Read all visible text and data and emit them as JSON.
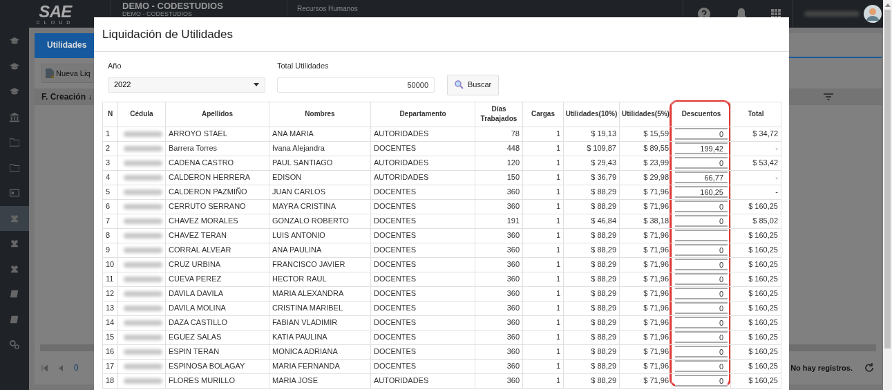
{
  "header": {
    "logo": "SAE",
    "logo_sub": "CLOUD",
    "company": "DEMO - CODESTUDIOS",
    "company_sub": "DEMO - CODESTUDIOS",
    "module": "Recursos Humanos"
  },
  "sidebar": {
    "items": [
      {
        "kind": "cap",
        "selected": false
      },
      {
        "kind": "cap",
        "selected": false
      },
      {
        "kind": "cap",
        "selected": false
      },
      {
        "kind": "bank",
        "selected": false
      },
      {
        "kind": "folder",
        "selected": false
      },
      {
        "kind": "folder",
        "selected": false
      },
      {
        "kind": "card",
        "selected": false
      },
      {
        "kind": "users",
        "selected": true
      },
      {
        "kind": "users",
        "selected": false
      },
      {
        "kind": "users",
        "selected": false
      },
      {
        "kind": "book",
        "selected": false
      },
      {
        "kind": "book",
        "selected": false
      },
      {
        "kind": "gears",
        "selected": false
      }
    ]
  },
  "background": {
    "tabs": [
      {
        "label": "Utilidades",
        "selected": true
      }
    ],
    "new_button": "Nueva Liq",
    "column": "F. Creación ↓",
    "empty_text": "No hay registros.",
    "page": "0"
  },
  "modal": {
    "title": "Liquidación de Utilidades",
    "year": {
      "label": "Año",
      "value": "2022"
    },
    "total": {
      "label": "Total Utilidades",
      "value": "50000"
    },
    "search_button": "Buscar",
    "columns": [
      "N",
      "Cédula",
      "Apellidos",
      "Nombres",
      "Departamento",
      "Días Trabajados",
      "Cargas",
      "Utilidades(10%)",
      "Utilidades(5%)",
      "Descuentos",
      "Total"
    ],
    "rows": [
      {
        "n": "1",
        "apellidos": "ARROYO STAEL",
        "nombres": "ANA MARIA",
        "departamento": "AUTORIDADES",
        "dias": "78",
        "cargas": "1",
        "util10": "$ 19,13",
        "util5": "$ 15,59",
        "descuento": "0",
        "total": "$ 34,72"
      },
      {
        "n": "2",
        "apellidos": "Barrera Torres",
        "nombres": "Ivana Alejandra",
        "departamento": "DOCENTES",
        "dias": "448",
        "cargas": "1",
        "util10": "$ 109,87",
        "util5": "$ 89,55",
        "descuento": "199,42",
        "total": "-"
      },
      {
        "n": "3",
        "apellidos": "CADENA CASTRO",
        "nombres": "PAUL SANTIAGO",
        "departamento": "AUTORIDADES",
        "dias": "120",
        "cargas": "1",
        "util10": "$ 29,43",
        "util5": "$ 23,99",
        "descuento": "0",
        "total": "$ 53,42"
      },
      {
        "n": "4",
        "apellidos": "CALDERON HERRERA",
        "nombres": "EDISON",
        "departamento": "AUTORIDADES",
        "dias": "150",
        "cargas": "1",
        "util10": "$ 36,79",
        "util5": "$ 29,98",
        "descuento": "66,77",
        "total": "-"
      },
      {
        "n": "5",
        "apellidos": "CALDERON PAZMIÑO",
        "nombres": "JUAN CARLOS",
        "departamento": "DOCENTES",
        "dias": "360",
        "cargas": "1",
        "util10": "$ 88,29",
        "util5": "$ 71,96",
        "descuento": "160,25",
        "total": "-"
      },
      {
        "n": "6",
        "apellidos": "CERRUTO SERRANO",
        "nombres": "MAYRA CRISTINA",
        "departamento": "DOCENTES",
        "dias": "360",
        "cargas": "1",
        "util10": "$ 88,29",
        "util5": "$ 71,96",
        "descuento": "0",
        "total": "$ 160,25"
      },
      {
        "n": "7",
        "apellidos": "CHAVEZ MORALES",
        "nombres": "GONZALO ROBERTO",
        "departamento": "DOCENTES",
        "dias": "191",
        "cargas": "1",
        "util10": "$ 46,84",
        "util5": "$ 38,18",
        "descuento": "0",
        "total": "$ 85,02"
      },
      {
        "n": "8",
        "apellidos": "CHAVEZ TERAN",
        "nombres": "LUIS ANTONIO",
        "departamento": "DOCENTES",
        "dias": "360",
        "cargas": "1",
        "util10": "$ 88,29",
        "util5": "$ 71,96",
        "total": "$ 160,25"
      },
      {
        "n": "9",
        "apellidos": "CORRAL ALVEAR",
        "nombres": "ANA PAULINA",
        "departamento": "DOCENTES",
        "dias": "360",
        "cargas": "1",
        "util10": "$ 88,29",
        "util5": "$ 71,96",
        "descuento": "0",
        "total": "$ 160,25"
      },
      {
        "n": "10",
        "apellidos": "CRUZ URBINA",
        "nombres": "FRANCISCO JAVIER",
        "departamento": "DOCENTES",
        "dias": "360",
        "cargas": "1",
        "util10": "$ 88,29",
        "util5": "$ 71,96",
        "descuento": "0",
        "total": "$ 160,25"
      },
      {
        "n": "11",
        "apellidos": "CUEVA PEREZ",
        "nombres": "HECTOR RAUL",
        "departamento": "DOCENTES",
        "dias": "360",
        "cargas": "1",
        "util10": "$ 88,29",
        "util5": "$ 71,96",
        "descuento": "0",
        "total": "$ 160,25"
      },
      {
        "n": "12",
        "apellidos": "DAVILA DAVILA",
        "nombres": "MARIA ALEXANDRA",
        "departamento": "DOCENTES",
        "dias": "360",
        "cargas": "1",
        "util10": "$ 88,29",
        "util5": "$ 71,96",
        "descuento": "0",
        "total": "$ 160,25"
      },
      {
        "n": "13",
        "apellidos": "DAVILA MOLINA",
        "nombres": "CRISTINA MARIBEL",
        "departamento": "DOCENTES",
        "dias": "360",
        "cargas": "1",
        "util10": "$ 88,29",
        "util5": "$ 71,96",
        "descuento": "0",
        "total": "$ 160,25"
      },
      {
        "n": "14",
        "apellidos": "DAZA CASTILLO",
        "nombres": "FABIAN VLADIMIR",
        "departamento": "DOCENTES",
        "dias": "360",
        "cargas": "1",
        "util10": "$ 88,29",
        "util5": "$ 71,96",
        "descuento": "0",
        "total": "$ 160,25"
      },
      {
        "n": "15",
        "apellidos": "EGUEZ SALAS",
        "nombres": "KATIA PAULINA",
        "departamento": "DOCENTES",
        "dias": "360",
        "cargas": "1",
        "util10": "$ 88,29",
        "util5": "$ 71,96",
        "descuento": "0",
        "total": "$ 160,25"
      },
      {
        "n": "16",
        "apellidos": "ESPIN TERAN",
        "nombres": "MONICA ADRIANA",
        "departamento": "DOCENTES",
        "dias": "360",
        "cargas": "1",
        "util10": "$ 88,29",
        "util5": "$ 71,96",
        "descuento": "0",
        "total": "$ 160,25"
      },
      {
        "n": "17",
        "apellidos": "ESPINOSA BOLAGAY",
        "nombres": "MARIA FERNANDA",
        "departamento": "DOCENTES",
        "dias": "360",
        "cargas": "1",
        "util10": "$ 88,29",
        "util5": "$ 71,96",
        "descuento": "0",
        "total": "$ 160,25"
      },
      {
        "n": "18",
        "apellidos": "FLORES MURILLO",
        "nombres": "MARIA JOSE",
        "departamento": "AUTORIDADES",
        "dias": "360",
        "cargas": "1",
        "util10": "$ 88,29",
        "util5": "$ 71,96",
        "descuento": "0",
        "total": "$ 160,25"
      }
    ]
  }
}
